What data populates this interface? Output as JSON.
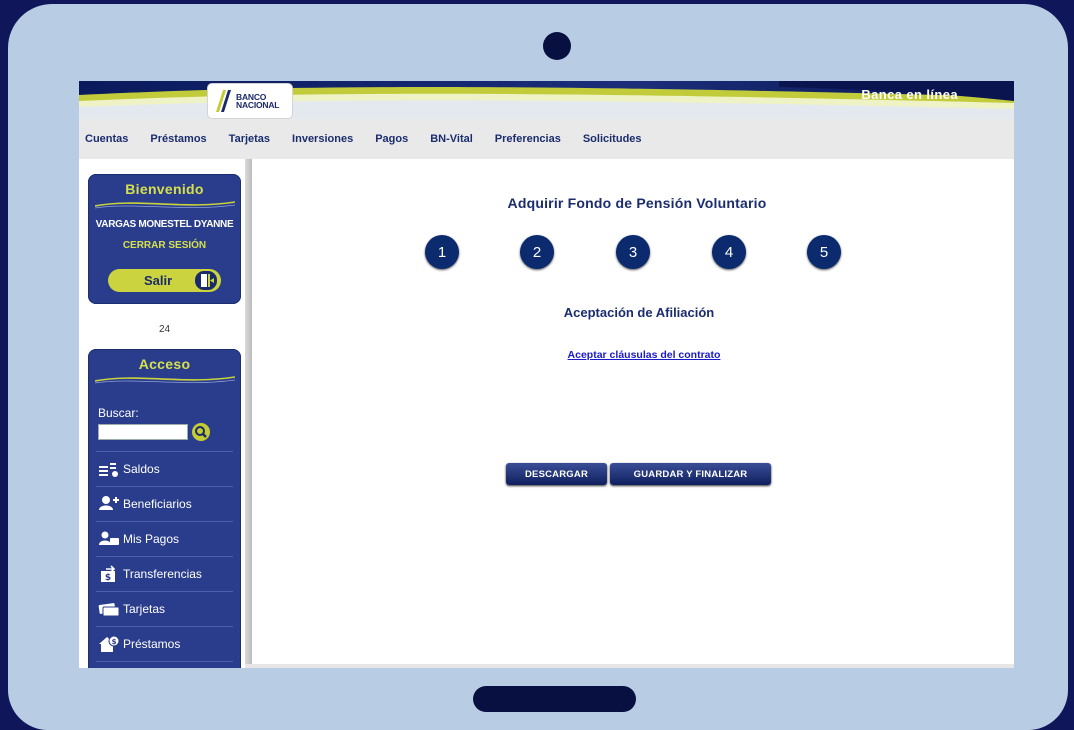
{
  "header": {
    "brand_line1": "BANCO",
    "brand_line2": "NACIONAL",
    "banca_label": "Banca en línea"
  },
  "nav": {
    "items": [
      "Cuentas",
      "Préstamos",
      "Tarjetas",
      "Inversiones",
      "Pagos",
      "BN-Vital",
      "Preferencias",
      "Solicitudes"
    ]
  },
  "welcome_panel": {
    "title": "Bienvenido",
    "user_name": "VARGAS MONESTEL DYANNE",
    "logout_link": "CERRAR SESIÓN",
    "salir_label": "Salir"
  },
  "counter": "24",
  "access_panel": {
    "title": "Acceso",
    "search_label": "Buscar:",
    "search_value": "",
    "menu": [
      "Saldos",
      "Beneficiarios",
      "Mis Pagos",
      "Transferencias",
      "Tarjetas",
      "Préstamos"
    ]
  },
  "main": {
    "title": "Adquirir Fondo de Pensión Voluntario",
    "steps": [
      "1",
      "2",
      "3",
      "4",
      "5"
    ],
    "section_title": "Aceptación de Afiliación",
    "contract_link": "Aceptar cláusulas del contrato",
    "download_label": "DESCARGAR",
    "save_finish_label": "GUARDAR Y FINALIZAR"
  },
  "colors": {
    "frame_bg": "#10165a",
    "tablet": "#b8cde4",
    "panel": "#2a3d8c",
    "accent_yellow": "#cbd43f",
    "step_circle": "#0c2a6e"
  }
}
